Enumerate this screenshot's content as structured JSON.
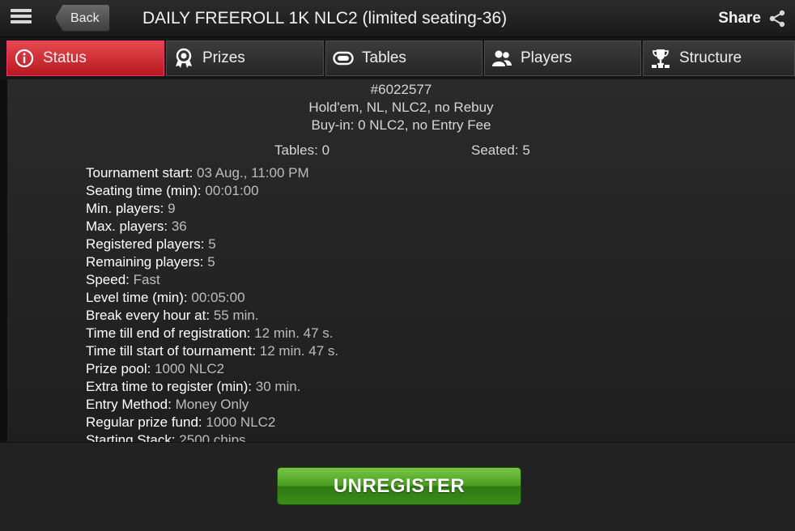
{
  "topbar": {
    "back_label": "Back",
    "title": "DAILY FREEROLL 1K NLC2 (limited seating-36)",
    "share_label": "Share"
  },
  "tabs": [
    {
      "label": "Status",
      "icon": "info-icon",
      "active": true
    },
    {
      "label": "Prizes",
      "icon": "medal-icon",
      "active": false
    },
    {
      "label": "Tables",
      "icon": "poker-table-icon",
      "active": false
    },
    {
      "label": "Players",
      "icon": "players-icon",
      "active": false
    },
    {
      "label": "Structure",
      "icon": "trophy-icon",
      "active": false
    }
  ],
  "summary": {
    "id": "#6022577",
    "game": "Hold'em, NL, NLC2, no Rebuy",
    "buyin": "Buy-in: 0 NLC2, no Entry Fee",
    "tables": "Tables: 0",
    "seated": "Seated: 5"
  },
  "details": [
    {
      "label": "Tournament start:",
      "value": "03 Aug., 11:00 PM"
    },
    {
      "label": "Seating time (min):",
      "value": "00:01:00"
    },
    {
      "label": "Min. players:",
      "value": "9"
    },
    {
      "label": "Max. players:",
      "value": "36"
    },
    {
      "label": "Registered players:",
      "value": "5"
    },
    {
      "label": "Remaining players:",
      "value": "5"
    },
    {
      "label": "Speed:",
      "value": "Fast"
    },
    {
      "label": "Level time (min):",
      "value": "00:05:00"
    },
    {
      "label": "Break every hour at:",
      "value": "55 min."
    },
    {
      "label": "Time till end of registration:",
      "value": "12 min. 47 s."
    },
    {
      "label": "Time till start of tournament:",
      "value": "12 min. 47 s."
    },
    {
      "label": "Prize pool:",
      "value": "1000 NLC2"
    },
    {
      "label": "Extra time to register (min):",
      "value": "30 min."
    },
    {
      "label": "Entry Method:",
      "value": "Money Only"
    },
    {
      "label": "Regular prize fund:",
      "value": "1000 NLC2"
    },
    {
      "label": "Starting Stack:",
      "value": "2500 chips"
    }
  ],
  "action": {
    "unregister_label": "UNREGISTER"
  },
  "colors": {
    "active_tab": "#d9323a",
    "button_green": "#4a9f22"
  }
}
